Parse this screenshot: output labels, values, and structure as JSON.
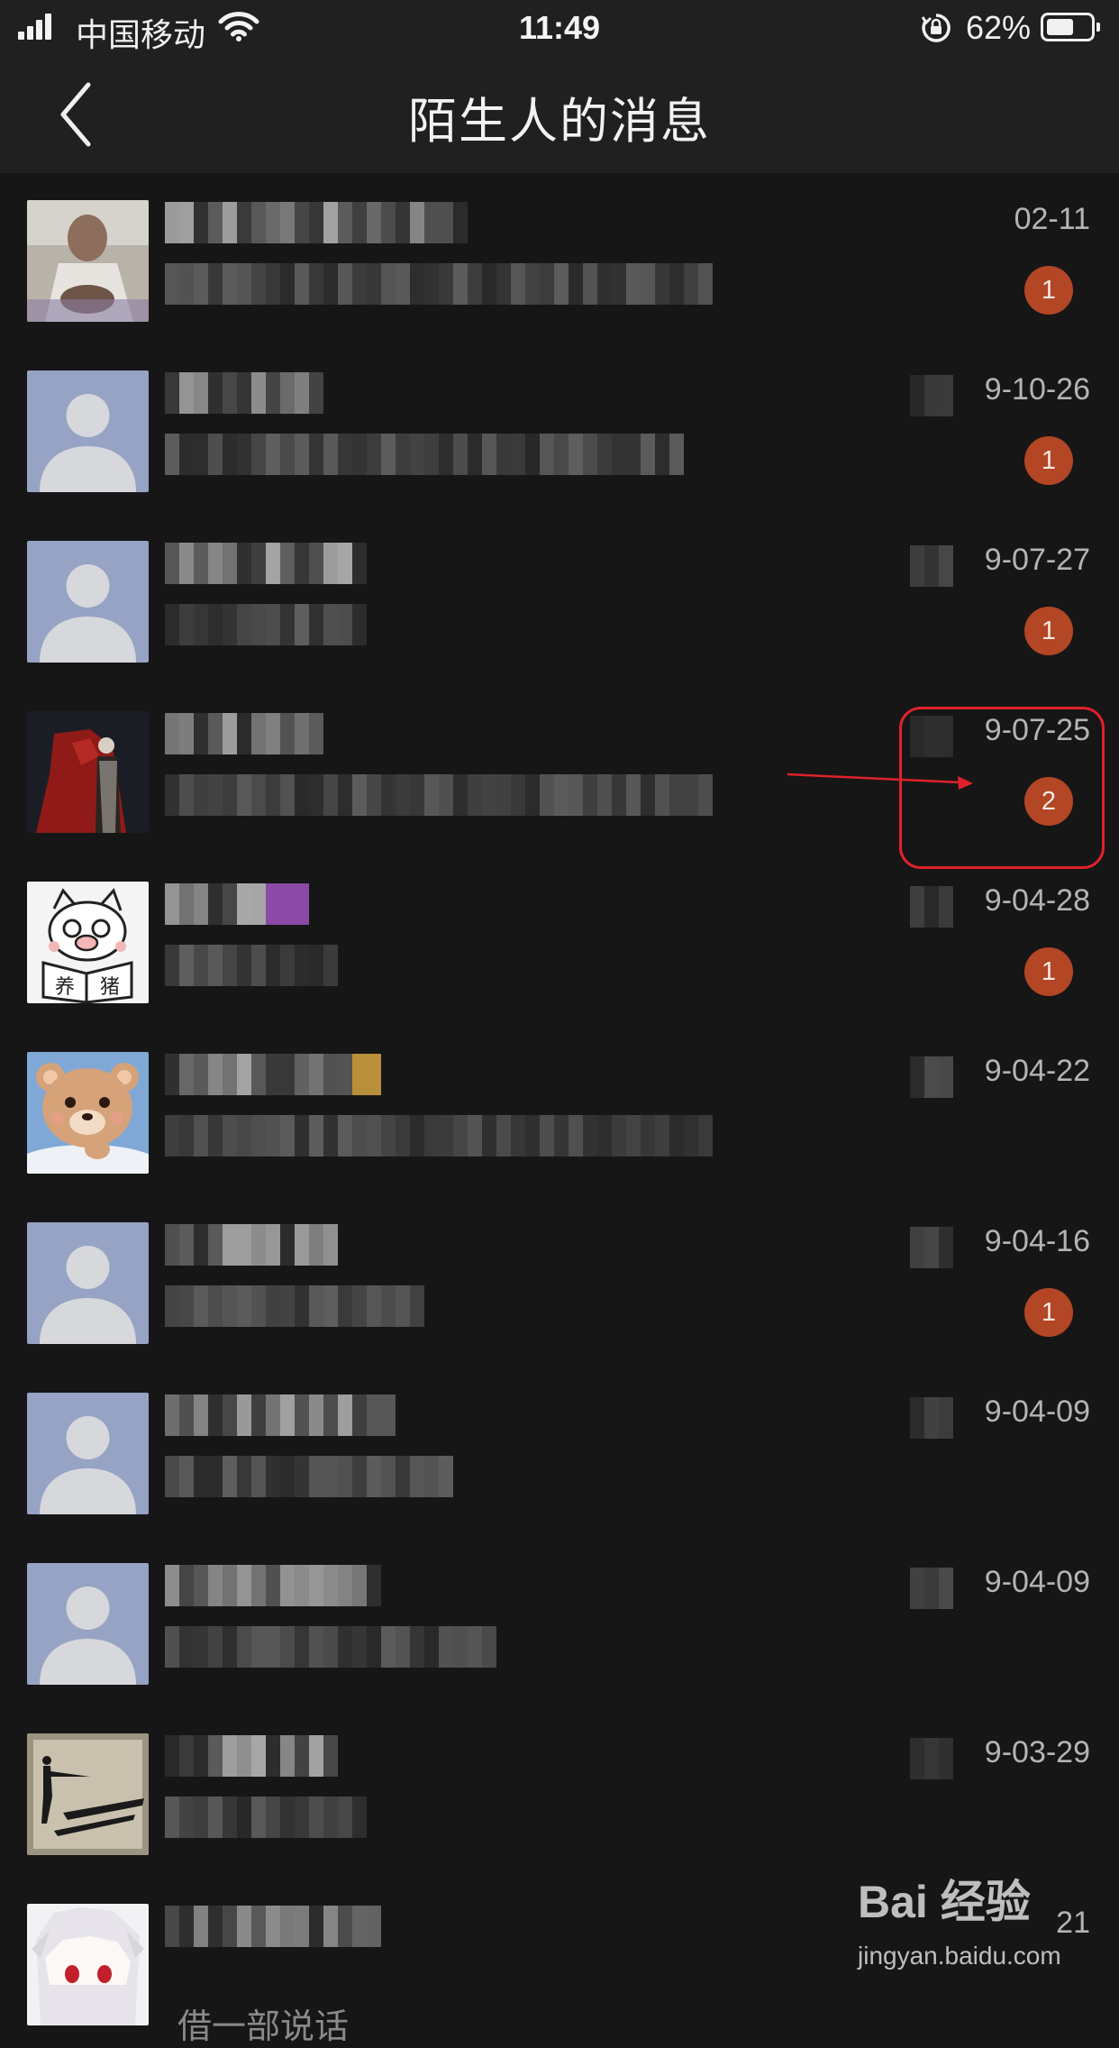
{
  "status_bar": {
    "carrier": "中国移动",
    "time": "11:49",
    "battery_percent": "62%",
    "battery_level": 0.62
  },
  "nav": {
    "title": "陌生人的消息",
    "back_icon": "chevron-left-icon"
  },
  "messages": [
    {
      "date": "02-11",
      "unread": "1",
      "avatar": "photo-avatar-figure"
    },
    {
      "date": "9-10-26",
      "unread": "1",
      "avatar": "default-avatar"
    },
    {
      "date": "9-07-27",
      "unread": "1",
      "avatar": "default-avatar"
    },
    {
      "date": "9-07-25",
      "unread": "2",
      "avatar": "photo-avatar-red-robe"
    },
    {
      "date": "9-04-28",
      "unread": "1",
      "avatar": "pig-sticker-avatar"
    },
    {
      "date": "9-04-22",
      "unread": "",
      "avatar": "bear-avatar"
    },
    {
      "date": "9-04-16",
      "unread": "1",
      "avatar": "default-avatar"
    },
    {
      "date": "9-04-09",
      "unread": "",
      "avatar": "default-avatar"
    },
    {
      "date": "9-04-09",
      "unread": "",
      "avatar": "default-avatar"
    },
    {
      "date": "9-03-29",
      "unread": "",
      "avatar": "photo-avatar-silhouette"
    },
    {
      "date": "21",
      "unread": "",
      "avatar": "anime-avatar",
      "preview_text": "借一部说话"
    }
  ],
  "watermark": {
    "logo": "Bai 经验",
    "url": "jingyan.baidu.com"
  },
  "colors": {
    "background": "#161616",
    "bar": "#202020",
    "badge": "#b34625",
    "annotation": "#e0212b",
    "default_avatar_bg": "#97a3c4"
  }
}
